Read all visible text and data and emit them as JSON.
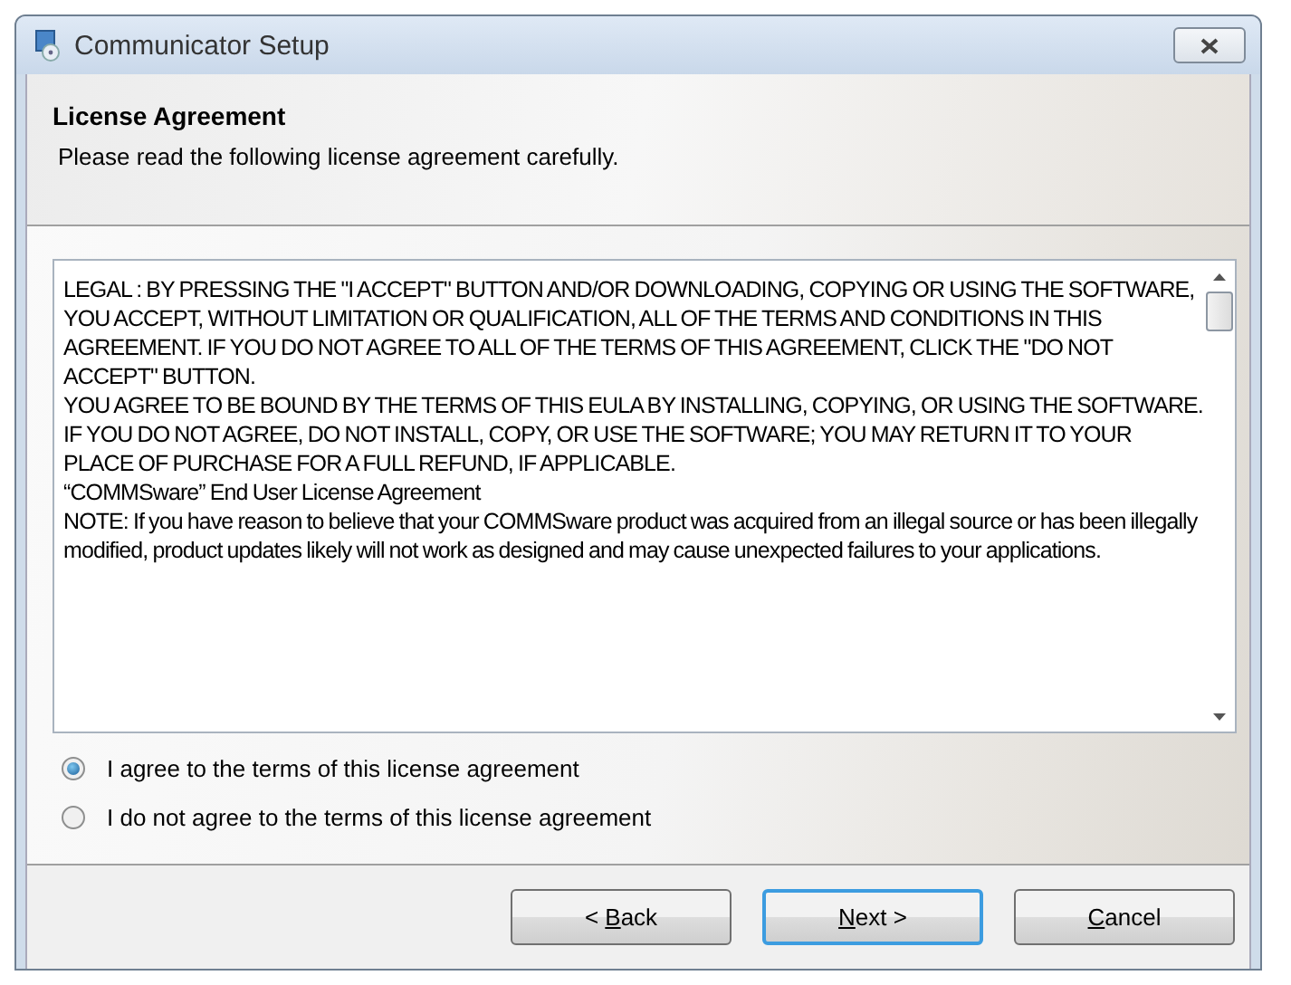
{
  "window": {
    "title": "Communicator Setup"
  },
  "header": {
    "title": "License Agreement",
    "subtitle": "Please read the following license agreement carefully."
  },
  "license_text": [
    "LEGAL : BY PRESSING THE \"I ACCEPT\" BUTTON AND/OR DOWNLOADING, COPYING OR USING THE SOFTWARE, YOU ACCEPT, WITHOUT LIMITATION OR QUALIFICATION, ALL OF THE TERMS AND CONDITIONS IN THIS AGREEMENT. IF YOU DO NOT AGREE TO ALL OF THE TERMS OF THIS AGREEMENT, CLICK THE \"DO NOT ACCEPT\" BUTTON.",
    "YOU AGREE TO BE BOUND BY THE TERMS OF THIS EULA BY INSTALLING, COPYING, OR USING THE SOFTWARE. IF YOU DO NOT AGREE, DO NOT INSTALL, COPY, OR USE THE SOFTWARE; YOU MAY RETURN IT TO YOUR PLACE OF PURCHASE FOR A FULL REFUND, IF APPLICABLE.",
    "“COMMSware” End User License Agreement",
    "NOTE: If you have reason to believe that your COMMSware product was acquired from an illegal source or has been illegally modified, product updates likely will not work as designed and may cause unexpected failures to your applications."
  ],
  "options": [
    {
      "label": "I agree to the terms of this license agreement",
      "selected": true
    },
    {
      "label": "I do not agree to the terms of this license agreement",
      "selected": false
    }
  ],
  "buttons": [
    {
      "label_before": "< ",
      "access_key": "B",
      "label_after": "ack",
      "default": false
    },
    {
      "access_key": "N",
      "label_after": "ext >",
      "default": true
    },
    {
      "access_key": "C",
      "label_after": "ancel",
      "default": false
    }
  ]
}
